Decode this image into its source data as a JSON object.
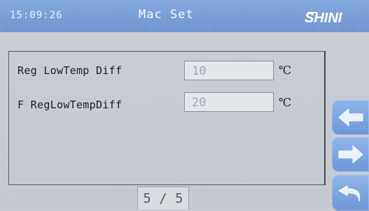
{
  "header": {
    "clock": "15:09:26",
    "title": "Mac Set",
    "logo": "SHINI"
  },
  "settings": [
    {
      "label": "Reg LowTemp Diff",
      "value": "10",
      "unit": "℃"
    },
    {
      "label": "F RegLowTempDiff",
      "value": "20",
      "unit": "℃"
    }
  ],
  "pagination": {
    "indicator": "5 / 5"
  },
  "nav": {
    "prev_icon": "arrow-left-icon",
    "next_icon": "arrow-right-icon",
    "back_icon": "return-icon"
  },
  "colors": {
    "header_bg": "#7ea6df",
    "screen_bg": "#c5c9cf",
    "button_bg": "#7ea6df"
  }
}
